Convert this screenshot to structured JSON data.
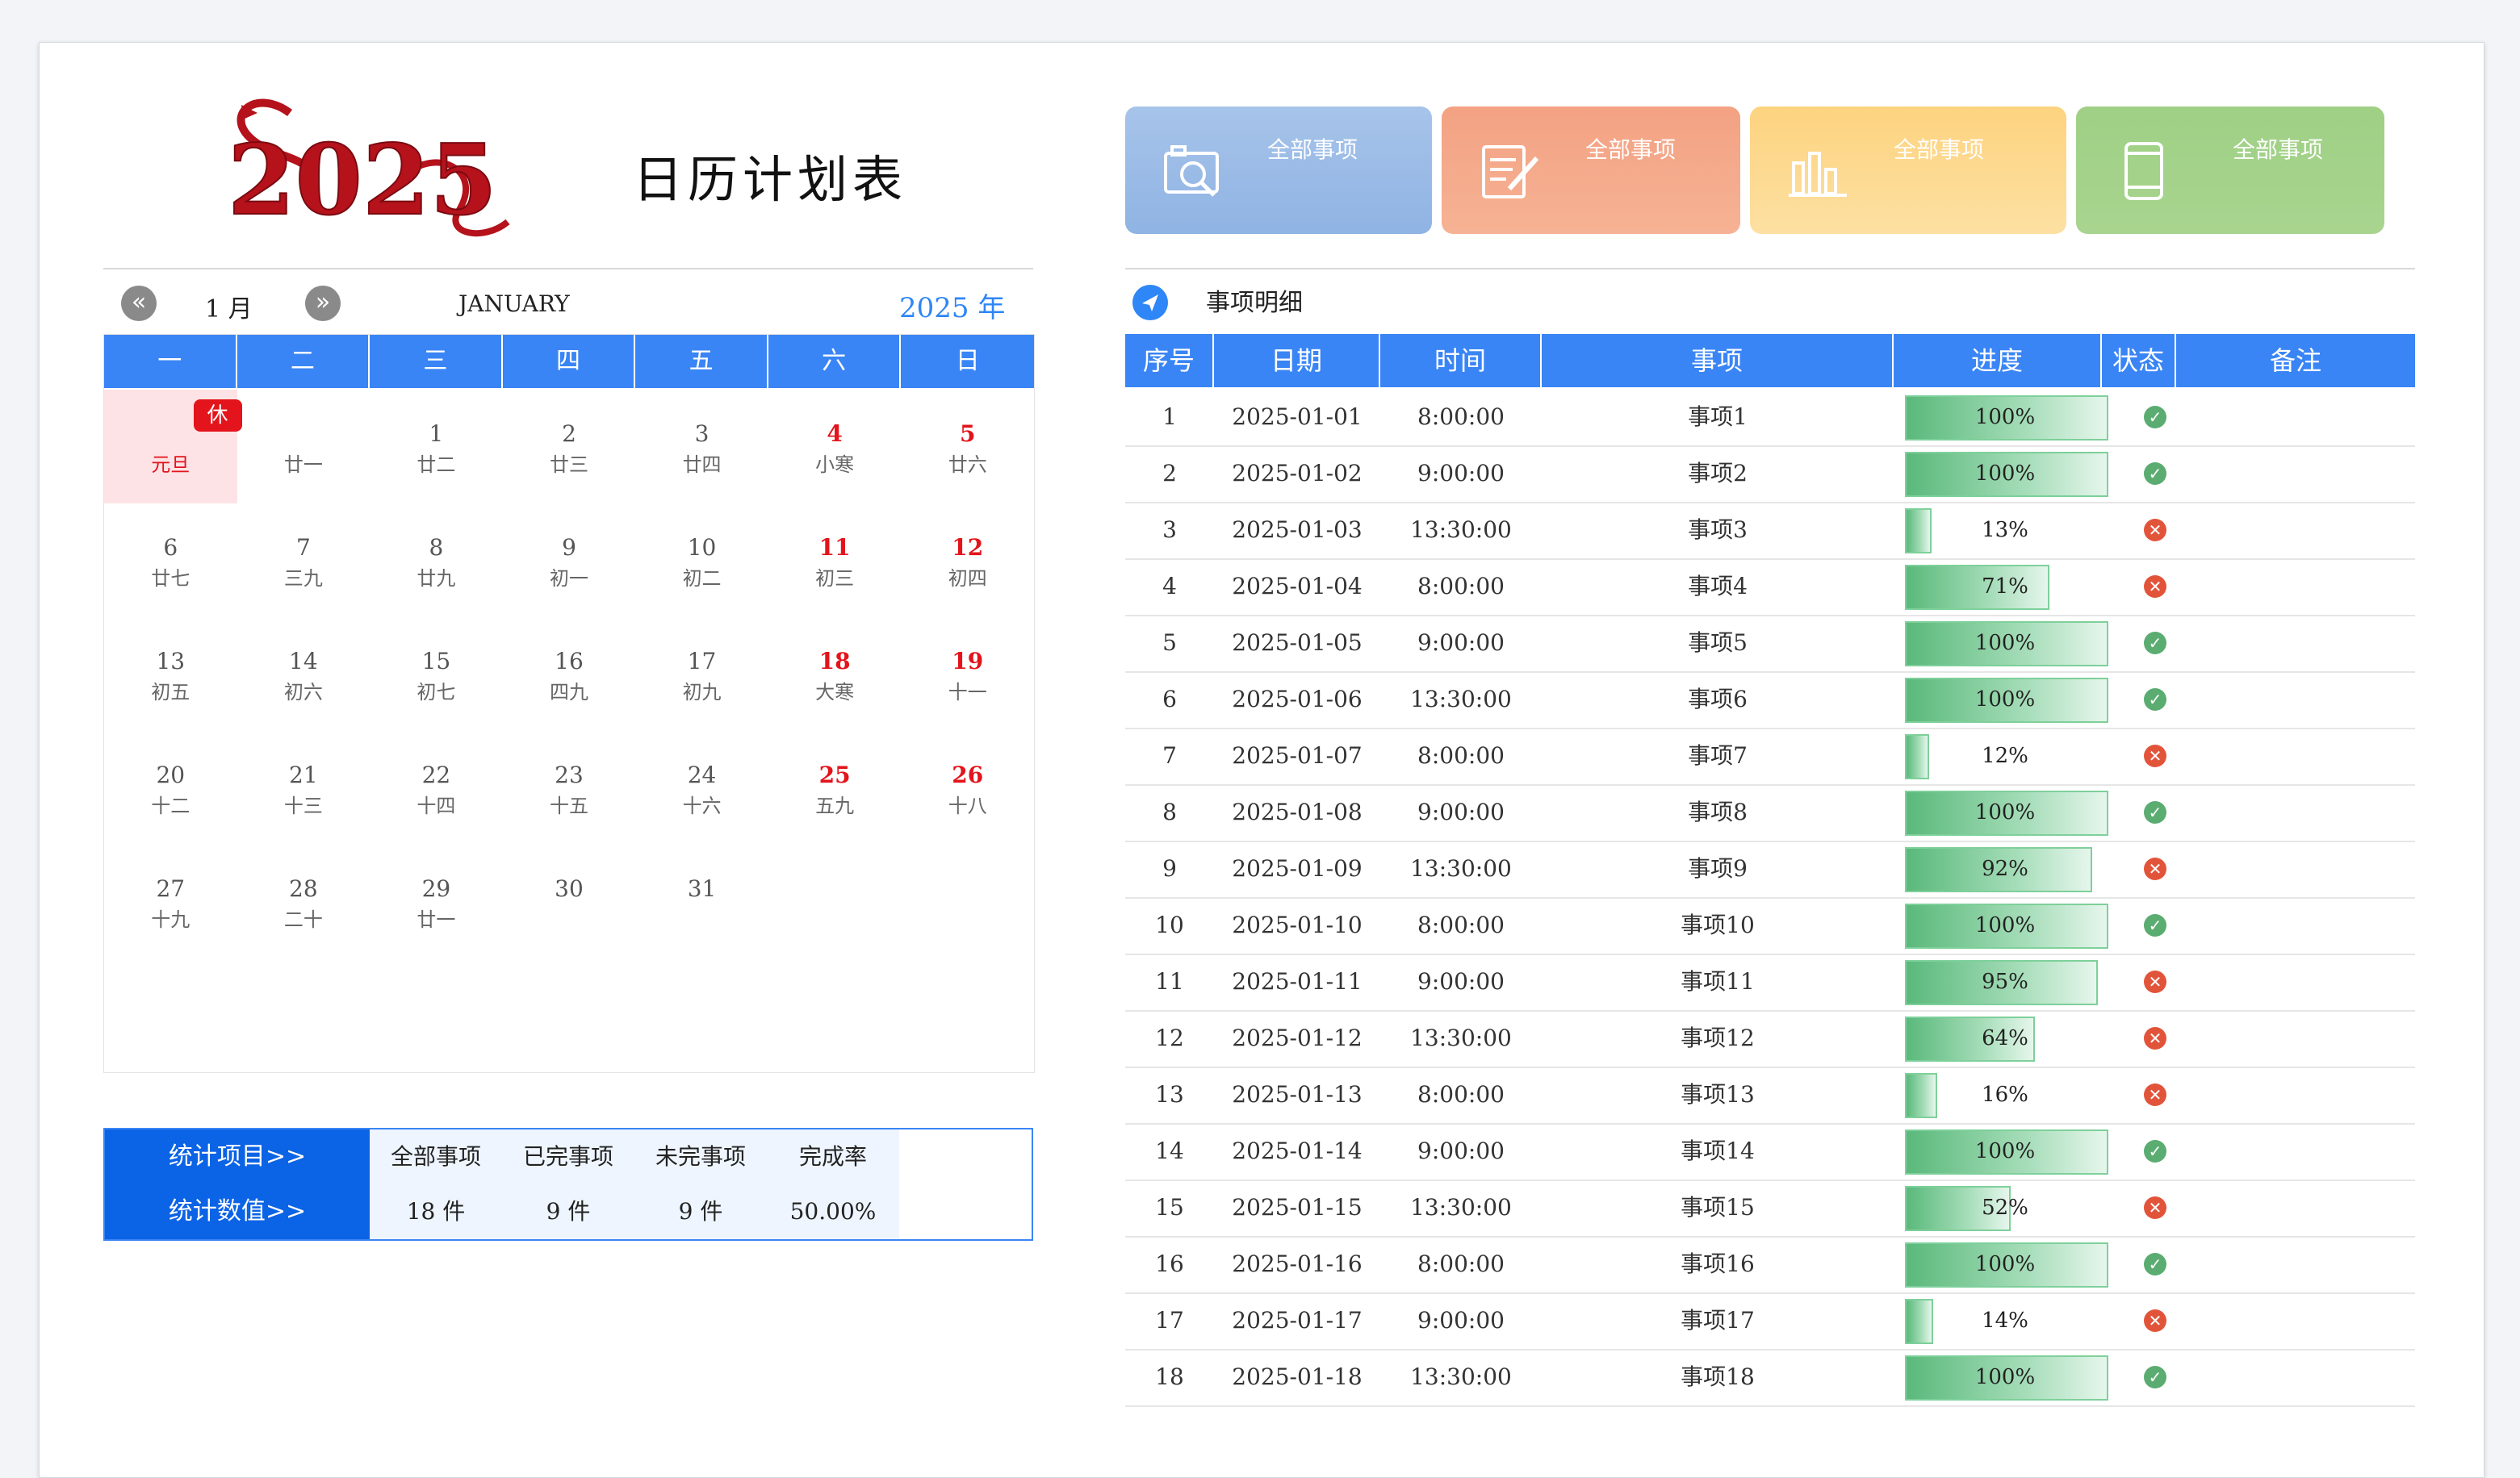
{
  "header": {
    "logo_text": "2025",
    "title": "日历计划表"
  },
  "calendar": {
    "month_label": "1 月",
    "month_en": "JANUARY",
    "year_label": "2025 年",
    "weekdays": [
      "一",
      "二",
      "三",
      "四",
      "五",
      "六",
      "日"
    ],
    "rest_badge": "休",
    "weeks": [
      [
        {
          "d": "",
          "l": "元旦",
          "holiday": true
        },
        {
          "d": "",
          "l": "廿一"
        },
        {
          "d": "1",
          "l": "廿二"
        },
        {
          "d": "2",
          "l": "廿三"
        },
        {
          "d": "3",
          "l": "廿四"
        },
        {
          "d": "4",
          "l": "小寒",
          "weekend": true
        },
        {
          "d": "5",
          "l": "廿六",
          "weekend": true
        }
      ],
      [
        {
          "d": "6",
          "l": "廿七"
        },
        {
          "d": "7",
          "l": "三九"
        },
        {
          "d": "8",
          "l": "廿九"
        },
        {
          "d": "9",
          "l": "初一"
        },
        {
          "d": "10",
          "l": "初二"
        },
        {
          "d": "11",
          "l": "初三",
          "weekend": true
        },
        {
          "d": "12",
          "l": "初四",
          "weekend": true
        }
      ],
      [
        {
          "d": "13",
          "l": "初五"
        },
        {
          "d": "14",
          "l": "初六"
        },
        {
          "d": "15",
          "l": "初七"
        },
        {
          "d": "16",
          "l": "四九"
        },
        {
          "d": "17",
          "l": "初九"
        },
        {
          "d": "18",
          "l": "大寒",
          "weekend": true
        },
        {
          "d": "19",
          "l": "十一",
          "weekend": true
        }
      ],
      [
        {
          "d": "20",
          "l": "十二"
        },
        {
          "d": "21",
          "l": "十三"
        },
        {
          "d": "22",
          "l": "十四"
        },
        {
          "d": "23",
          "l": "十五"
        },
        {
          "d": "24",
          "l": "十六"
        },
        {
          "d": "25",
          "l": "五九",
          "weekend": true
        },
        {
          "d": "26",
          "l": "十八",
          "weekend": true
        }
      ],
      [
        {
          "d": "27",
          "l": "十九"
        },
        {
          "d": "28",
          "l": "二十"
        },
        {
          "d": "29",
          "l": "廿一"
        },
        {
          "d": "30",
          "l": ""
        },
        {
          "d": "31",
          "l": ""
        },
        {
          "d": "",
          "l": ""
        },
        {
          "d": "",
          "l": ""
        }
      ]
    ]
  },
  "stats": {
    "row1_label": "统计项目>>",
    "row2_label": "统计数值>>",
    "headers": [
      "全部事项",
      "已完事项",
      "未完事项",
      "完成率"
    ],
    "values": [
      "18 件",
      "9 件",
      "9 件",
      "50.00%"
    ]
  },
  "cards": [
    {
      "label": "全部事项",
      "icon": "photo-search-icon",
      "color_from": "#a7c4ea",
      "color_to": "#8fb3e3"
    },
    {
      "label": "全部事项",
      "icon": "edit-document-icon",
      "color_from": "#f3a283",
      "color_to": "#f6b294"
    },
    {
      "label": "全部事项",
      "icon": "bar-chart-icon",
      "color_from": "#fdd37f",
      "color_to": "#fde0a2"
    },
    {
      "label": "全部事项",
      "icon": "tablet-icon",
      "color_from": "#9fd085",
      "color_to": "#a8d48f"
    }
  ],
  "detail": {
    "section_title": "事项明细",
    "columns": [
      "序号",
      "日期",
      "时间",
      "事项",
      "进度",
      "状态",
      "备注"
    ],
    "rows": [
      {
        "no": "1",
        "date": "2025-01-01",
        "time": "8:00:00",
        "item": "事项1",
        "progress": 100,
        "pct": "100%",
        "done": true
      },
      {
        "no": "2",
        "date": "2025-01-02",
        "time": "9:00:00",
        "item": "事项2",
        "progress": 100,
        "pct": "100%",
        "done": true
      },
      {
        "no": "3",
        "date": "2025-01-03",
        "time": "13:30:00",
        "item": "事项3",
        "progress": 13,
        "pct": "13%",
        "done": false
      },
      {
        "no": "4",
        "date": "2025-01-04",
        "time": "8:00:00",
        "item": "事项4",
        "progress": 71,
        "pct": "71%",
        "done": false
      },
      {
        "no": "5",
        "date": "2025-01-05",
        "time": "9:00:00",
        "item": "事项5",
        "progress": 100,
        "pct": "100%",
        "done": true
      },
      {
        "no": "6",
        "date": "2025-01-06",
        "time": "13:30:00",
        "item": "事项6",
        "progress": 100,
        "pct": "100%",
        "done": true
      },
      {
        "no": "7",
        "date": "2025-01-07",
        "time": "8:00:00",
        "item": "事项7",
        "progress": 12,
        "pct": "12%",
        "done": false
      },
      {
        "no": "8",
        "date": "2025-01-08",
        "time": "9:00:00",
        "item": "事项8",
        "progress": 100,
        "pct": "100%",
        "done": true
      },
      {
        "no": "9",
        "date": "2025-01-09",
        "time": "13:30:00",
        "item": "事项9",
        "progress": 92,
        "pct": "92%",
        "done": false
      },
      {
        "no": "10",
        "date": "2025-01-10",
        "time": "8:00:00",
        "item": "事项10",
        "progress": 100,
        "pct": "100%",
        "done": true
      },
      {
        "no": "11",
        "date": "2025-01-11",
        "time": "9:00:00",
        "item": "事项11",
        "progress": 95,
        "pct": "95%",
        "done": false
      },
      {
        "no": "12",
        "date": "2025-01-12",
        "time": "13:30:00",
        "item": "事项12",
        "progress": 64,
        "pct": "64%",
        "done": false
      },
      {
        "no": "13",
        "date": "2025-01-13",
        "time": "8:00:00",
        "item": "事项13",
        "progress": 16,
        "pct": "16%",
        "done": false
      },
      {
        "no": "14",
        "date": "2025-01-14",
        "time": "9:00:00",
        "item": "事项14",
        "progress": 100,
        "pct": "100%",
        "done": true
      },
      {
        "no": "15",
        "date": "2025-01-15",
        "time": "13:30:00",
        "item": "事项15",
        "progress": 52,
        "pct": "52%",
        "done": false
      },
      {
        "no": "16",
        "date": "2025-01-16",
        "time": "8:00:00",
        "item": "事项16",
        "progress": 100,
        "pct": "100%",
        "done": true
      },
      {
        "no": "17",
        "date": "2025-01-17",
        "time": "9:00:00",
        "item": "事项17",
        "progress": 14,
        "pct": "14%",
        "done": false
      },
      {
        "no": "18",
        "date": "2025-01-18",
        "time": "13:30:00",
        "item": "事项18",
        "progress": 100,
        "pct": "100%",
        "done": true
      }
    ]
  },
  "colors": {
    "accent_blue": "#3a85f5",
    "dark_blue": "#0b63e5",
    "holiday_red": "#e3141b",
    "done_green": "#5aac71",
    "undone_red": "#e2543a"
  }
}
